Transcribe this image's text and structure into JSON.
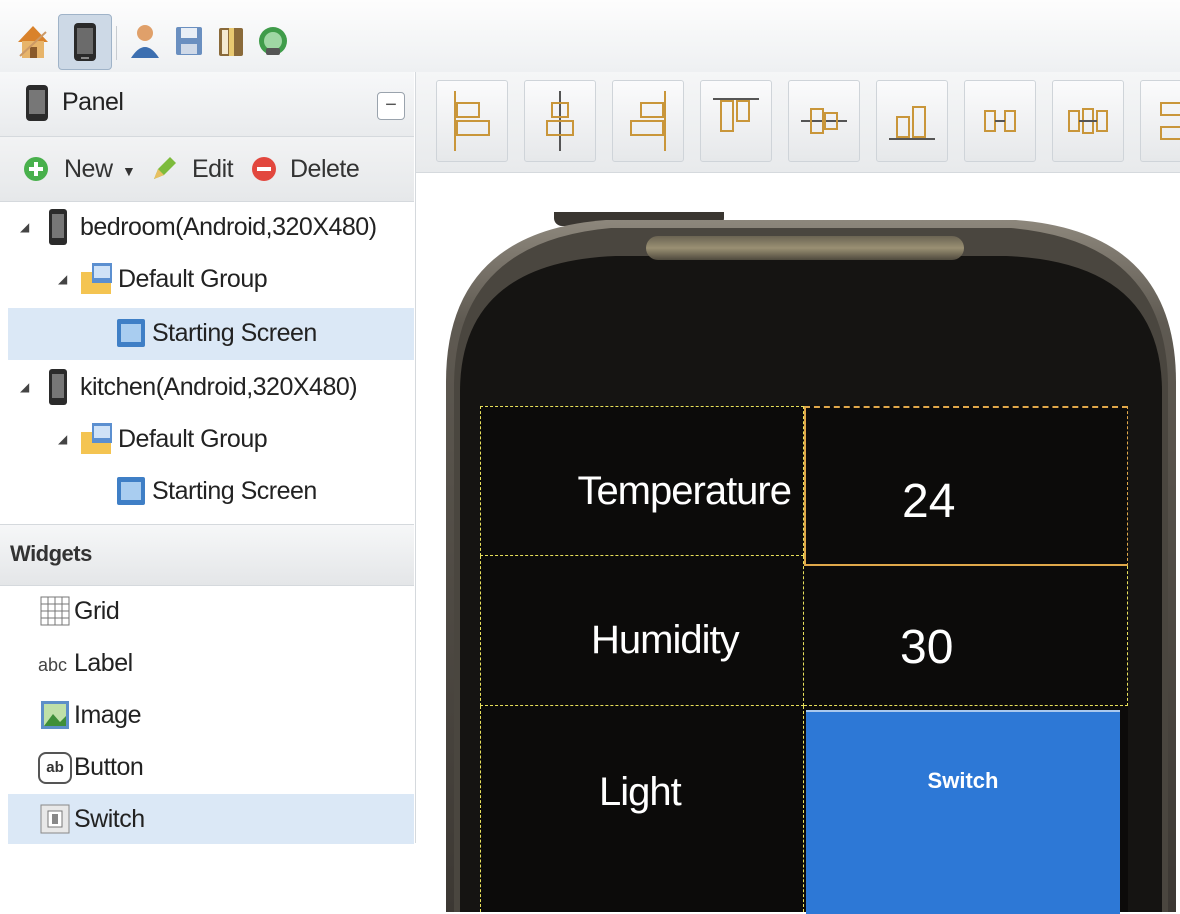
{
  "panel": {
    "title": "Panel",
    "collapse": "−"
  },
  "actions": {
    "new": "New",
    "edit": "Edit",
    "delete": "Delete"
  },
  "tree": {
    "bedroom": "bedroom(Android,320X480)",
    "bedroom_group": "Default Group",
    "bedroom_screen": "Starting Screen",
    "kitchen": "kitchen(Android,320X480)",
    "kitchen_group": "Default Group",
    "kitchen_screen": "Starting Screen"
  },
  "widgets": {
    "title": "Widgets",
    "items": [
      {
        "label": "Grid",
        "icon": "grid-icon"
      },
      {
        "label": "Label",
        "icon": "label-icon",
        "prefix": "abc"
      },
      {
        "label": "Image",
        "icon": "image-icon"
      },
      {
        "label": "Button",
        "icon": "button-icon",
        "prefix": "ab"
      },
      {
        "label": "Switch",
        "icon": "switch-icon"
      }
    ]
  },
  "screen": {
    "temperature_label": "Temperature",
    "temperature_value": "24",
    "humidity_label": "Humidity",
    "humidity_value": "30",
    "light_label": "Light",
    "switch_label": "Switch"
  },
  "colors": {
    "accent": "#2d78d6",
    "selection": "#dbe8f6",
    "phone_body": "#4a463f"
  }
}
